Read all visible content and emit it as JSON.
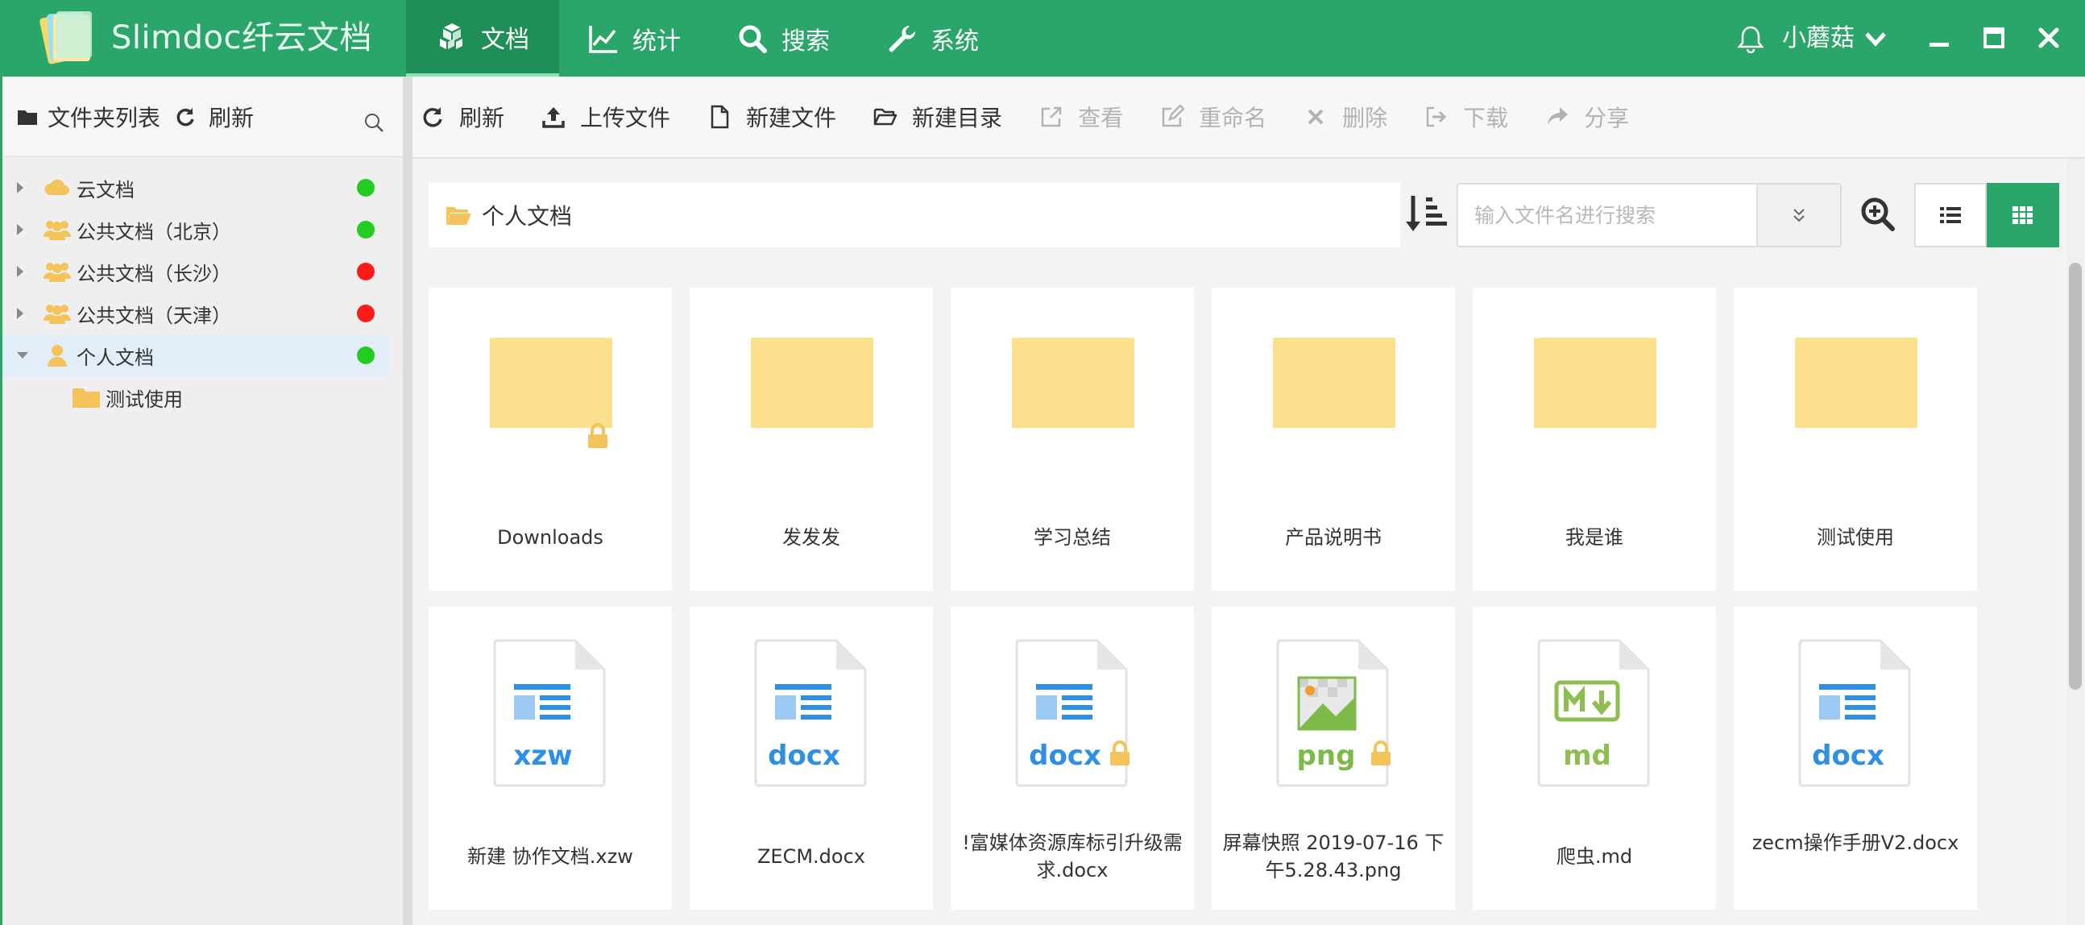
{
  "app": {
    "brand": "Slimdoc纤云文档",
    "accent": "#2ba66a"
  },
  "nav": [
    {
      "label": "文档",
      "icon": "cubes-icon",
      "active": true
    },
    {
      "label": "统计",
      "icon": "line-chart-icon",
      "active": false
    },
    {
      "label": "搜索",
      "icon": "search-icon",
      "active": false
    },
    {
      "label": "系统",
      "icon": "wrench-icon",
      "active": false
    }
  ],
  "user": {
    "name": "小蘑菇"
  },
  "sidebar": {
    "title": "文件夹列表",
    "refresh": "刷新",
    "items": [
      {
        "label": "云文档",
        "icon": "cloud-icon",
        "status": "#22cc22",
        "expanded": false
      },
      {
        "label": "公共文档（北京）",
        "icon": "users-icon",
        "status": "#22cc22",
        "expanded": false
      },
      {
        "label": "公共文档（长沙）",
        "icon": "users-icon",
        "status": "#ff1a1a",
        "expanded": false
      },
      {
        "label": "公共文档（天津）",
        "icon": "users-icon",
        "status": "#ff1a1a",
        "expanded": false
      },
      {
        "label": "个人文档",
        "icon": "user-icon",
        "status": "#22cc22",
        "expanded": true,
        "selected": true
      },
      {
        "label": "测试使用",
        "icon": "folder-icon",
        "child": true
      }
    ]
  },
  "toolbar": {
    "refresh": "刷新",
    "upload": "上传文件",
    "new_file": "新建文件",
    "new_dir": "新建目录",
    "view": "查看",
    "rename": "重命名",
    "delete": "删除",
    "download": "下载",
    "share": "分享"
  },
  "path": {
    "current": "个人文档"
  },
  "search": {
    "placeholder": "输入文件名进行搜索"
  },
  "files": [
    {
      "name": "Downloads",
      "kind": "folder",
      "locked": true
    },
    {
      "name": "发发发",
      "kind": "folder",
      "locked": false
    },
    {
      "name": "学习总结",
      "kind": "folder",
      "locked": false
    },
    {
      "name": "产品说明书",
      "kind": "folder",
      "locked": false
    },
    {
      "name": "我是谁",
      "kind": "folder",
      "locked": false
    },
    {
      "name": "测试使用",
      "kind": "folder",
      "locked": false
    },
    {
      "name": "新建 协作文档.xzw",
      "kind": "doc",
      "ext": "xzw",
      "locked": false
    },
    {
      "name": "ZECM.docx",
      "kind": "doc",
      "ext": "docx",
      "locked": false
    },
    {
      "name": "!富媒体资源库标引升级需求.docx",
      "kind": "doc",
      "ext": "docx",
      "locked": true
    },
    {
      "name": "屏幕快照 2019-07-16 下午5.28.43.png",
      "kind": "image",
      "ext": "png",
      "locked": true
    },
    {
      "name": "爬虫.md",
      "kind": "markdown",
      "ext": "md",
      "locked": false
    },
    {
      "name": "zecm操作手册V2.docx",
      "kind": "doc",
      "ext": "docx",
      "locked": false
    }
  ]
}
